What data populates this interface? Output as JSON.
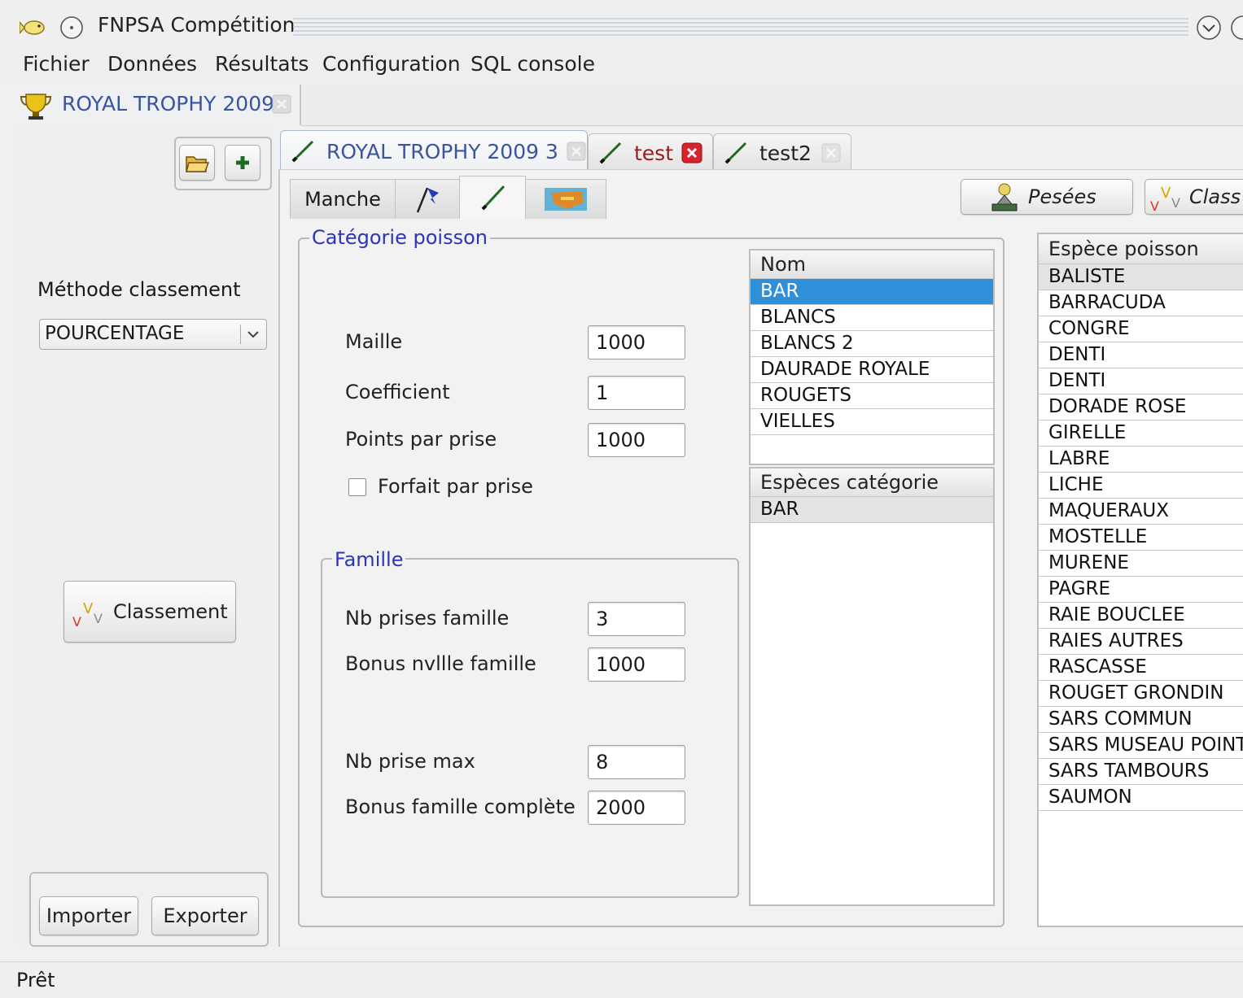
{
  "window": {
    "title": "FNPSA Compétition"
  },
  "menu": [
    "Fichier",
    "Données",
    "Résultats",
    "Configuration",
    "SQL console"
  ],
  "doc_tab": {
    "label": "ROYAL TROPHY 2009"
  },
  "left": {
    "method_label": "Méthode classement",
    "method_value": "POURCENTAGE",
    "classement_button": "Classement",
    "import_button": "Importer",
    "export_button": "Exporter"
  },
  "tabs": [
    {
      "label": "ROYAL TROPHY 2009 3"
    },
    {
      "label": "test"
    },
    {
      "label": "test2"
    }
  ],
  "subtabs": {
    "manche": "Manche"
  },
  "actions": {
    "pesees": "Pesées",
    "classement": "Class"
  },
  "categorie": {
    "title": "Catégorie poisson",
    "maille_label": "Maille",
    "maille_value": "1000",
    "coef_label": "Coefficient",
    "coef_value": "1",
    "points_label": "Points par prise",
    "points_value": "1000",
    "forfait_label": "Forfait par prise",
    "forfait_checked": false
  },
  "famille": {
    "title": "Famille",
    "nb_prises_label": "Nb prises famille",
    "nb_prises_value": "3",
    "bonus_nvlle_label": "Bonus nvllle famille",
    "bonus_nvlle_value": "1000",
    "nb_max_label": "Nb prise max",
    "nb_max_value": "8",
    "bonus_complete_label": "Bonus famille complète",
    "bonus_complete_value": "2000"
  },
  "nom_list": {
    "header": "Nom",
    "rows": [
      "BAR",
      "BLANCS",
      "BLANCS 2",
      "DAURADE ROYALE",
      "ROUGETS",
      "VIELLES"
    ],
    "selected": "BAR"
  },
  "especes_categorie": {
    "header": "Espèces catégorie",
    "rows": [
      "BAR"
    ]
  },
  "espece_poisson": {
    "header": "Espèce poisson",
    "rows": [
      "BALISTE",
      "BARRACUDA",
      "CONGRE",
      "DENTI",
      "DENTI",
      "DORADE ROSE",
      "GIRELLE",
      "LABRE",
      "LICHE",
      "MAQUERAUX",
      "MOSTELLE",
      "MURENE",
      "PAGRE",
      "RAIE BOUCLEE",
      "RAIES AUTRES",
      "RASCASSE",
      "ROUGET GRONDIN",
      "SARS COMMUN",
      "SARS MUSEAU POINTU",
      "SARS TAMBOURS",
      "SAUMON"
    ]
  },
  "status": "Prêt",
  "colors": {
    "selection": "#2f8fd8",
    "group_label": "#2a35b8",
    "tab_label": "#3a55a0",
    "test_label": "#9b1a1a"
  }
}
